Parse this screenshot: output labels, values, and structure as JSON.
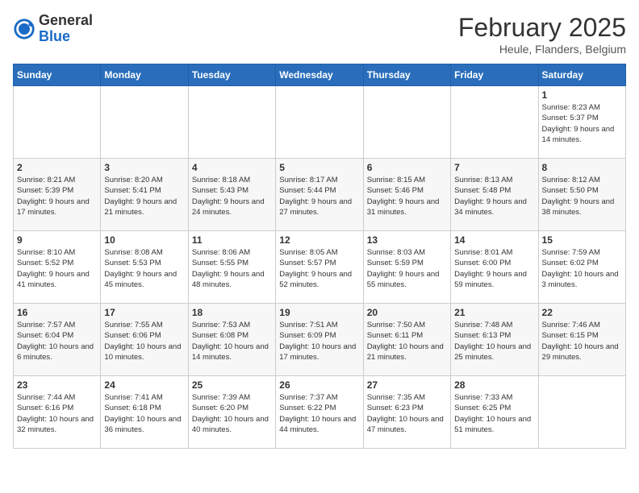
{
  "header": {
    "logo": {
      "general": "General",
      "blue": "Blue"
    },
    "title": "February 2025",
    "location": "Heule, Flanders, Belgium"
  },
  "weekdays": [
    "Sunday",
    "Monday",
    "Tuesday",
    "Wednesday",
    "Thursday",
    "Friday",
    "Saturday"
  ],
  "weeks": [
    [
      {
        "day": "",
        "info": ""
      },
      {
        "day": "",
        "info": ""
      },
      {
        "day": "",
        "info": ""
      },
      {
        "day": "",
        "info": ""
      },
      {
        "day": "",
        "info": ""
      },
      {
        "day": "",
        "info": ""
      },
      {
        "day": "1",
        "info": "Sunrise: 8:23 AM\nSunset: 5:37 PM\nDaylight: 9 hours and 14 minutes."
      }
    ],
    [
      {
        "day": "2",
        "info": "Sunrise: 8:21 AM\nSunset: 5:39 PM\nDaylight: 9 hours and 17 minutes."
      },
      {
        "day": "3",
        "info": "Sunrise: 8:20 AM\nSunset: 5:41 PM\nDaylight: 9 hours and 21 minutes."
      },
      {
        "day": "4",
        "info": "Sunrise: 8:18 AM\nSunset: 5:43 PM\nDaylight: 9 hours and 24 minutes."
      },
      {
        "day": "5",
        "info": "Sunrise: 8:17 AM\nSunset: 5:44 PM\nDaylight: 9 hours and 27 minutes."
      },
      {
        "day": "6",
        "info": "Sunrise: 8:15 AM\nSunset: 5:46 PM\nDaylight: 9 hours and 31 minutes."
      },
      {
        "day": "7",
        "info": "Sunrise: 8:13 AM\nSunset: 5:48 PM\nDaylight: 9 hours and 34 minutes."
      },
      {
        "day": "8",
        "info": "Sunrise: 8:12 AM\nSunset: 5:50 PM\nDaylight: 9 hours and 38 minutes."
      }
    ],
    [
      {
        "day": "9",
        "info": "Sunrise: 8:10 AM\nSunset: 5:52 PM\nDaylight: 9 hours and 41 minutes."
      },
      {
        "day": "10",
        "info": "Sunrise: 8:08 AM\nSunset: 5:53 PM\nDaylight: 9 hours and 45 minutes."
      },
      {
        "day": "11",
        "info": "Sunrise: 8:06 AM\nSunset: 5:55 PM\nDaylight: 9 hours and 48 minutes."
      },
      {
        "day": "12",
        "info": "Sunrise: 8:05 AM\nSunset: 5:57 PM\nDaylight: 9 hours and 52 minutes."
      },
      {
        "day": "13",
        "info": "Sunrise: 8:03 AM\nSunset: 5:59 PM\nDaylight: 9 hours and 55 minutes."
      },
      {
        "day": "14",
        "info": "Sunrise: 8:01 AM\nSunset: 6:00 PM\nDaylight: 9 hours and 59 minutes."
      },
      {
        "day": "15",
        "info": "Sunrise: 7:59 AM\nSunset: 6:02 PM\nDaylight: 10 hours and 3 minutes."
      }
    ],
    [
      {
        "day": "16",
        "info": "Sunrise: 7:57 AM\nSunset: 6:04 PM\nDaylight: 10 hours and 6 minutes."
      },
      {
        "day": "17",
        "info": "Sunrise: 7:55 AM\nSunset: 6:06 PM\nDaylight: 10 hours and 10 minutes."
      },
      {
        "day": "18",
        "info": "Sunrise: 7:53 AM\nSunset: 6:08 PM\nDaylight: 10 hours and 14 minutes."
      },
      {
        "day": "19",
        "info": "Sunrise: 7:51 AM\nSunset: 6:09 PM\nDaylight: 10 hours and 17 minutes."
      },
      {
        "day": "20",
        "info": "Sunrise: 7:50 AM\nSunset: 6:11 PM\nDaylight: 10 hours and 21 minutes."
      },
      {
        "day": "21",
        "info": "Sunrise: 7:48 AM\nSunset: 6:13 PM\nDaylight: 10 hours and 25 minutes."
      },
      {
        "day": "22",
        "info": "Sunrise: 7:46 AM\nSunset: 6:15 PM\nDaylight: 10 hours and 29 minutes."
      }
    ],
    [
      {
        "day": "23",
        "info": "Sunrise: 7:44 AM\nSunset: 6:16 PM\nDaylight: 10 hours and 32 minutes."
      },
      {
        "day": "24",
        "info": "Sunrise: 7:41 AM\nSunset: 6:18 PM\nDaylight: 10 hours and 36 minutes."
      },
      {
        "day": "25",
        "info": "Sunrise: 7:39 AM\nSunset: 6:20 PM\nDaylight: 10 hours and 40 minutes."
      },
      {
        "day": "26",
        "info": "Sunrise: 7:37 AM\nSunset: 6:22 PM\nDaylight: 10 hours and 44 minutes."
      },
      {
        "day": "27",
        "info": "Sunrise: 7:35 AM\nSunset: 6:23 PM\nDaylight: 10 hours and 47 minutes."
      },
      {
        "day": "28",
        "info": "Sunrise: 7:33 AM\nSunset: 6:25 PM\nDaylight: 10 hours and 51 minutes."
      },
      {
        "day": "",
        "info": ""
      }
    ]
  ]
}
